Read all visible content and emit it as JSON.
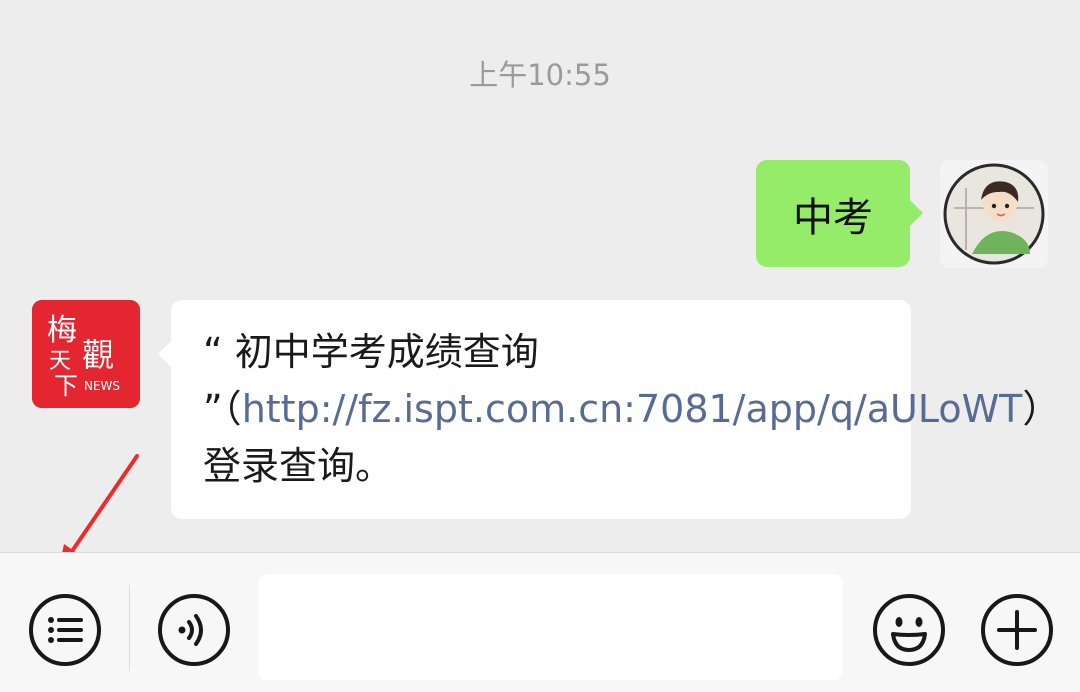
{
  "chat": {
    "timestamp": "上午10:55",
    "messages": [
      {
        "from": "me",
        "text": "中考"
      },
      {
        "from": "bot",
        "avatar_text": [
          "梅",
          "天",
          "觀",
          "下",
          "NEWS"
        ],
        "text_before": "“ 初中学考成绩查询 ”（",
        "link": "http://fz.ispt.com.cn:7081/app/q/aULoWT",
        "text_after": "）登录查询。"
      }
    ]
  },
  "toolbar": {
    "menu_icon": "menu-list-icon",
    "voice_icon": "voice-icon",
    "input_value": "",
    "emoji_icon": "emoji-icon",
    "plus_icon": "plus-icon"
  },
  "colors": {
    "background": "#ededed",
    "my_bubble": "#95ec69",
    "bot_bubble": "#ffffff",
    "link": "#576b95",
    "bot_avatar": "#e3262f",
    "annotation_arrow": "#f02a2a"
  }
}
